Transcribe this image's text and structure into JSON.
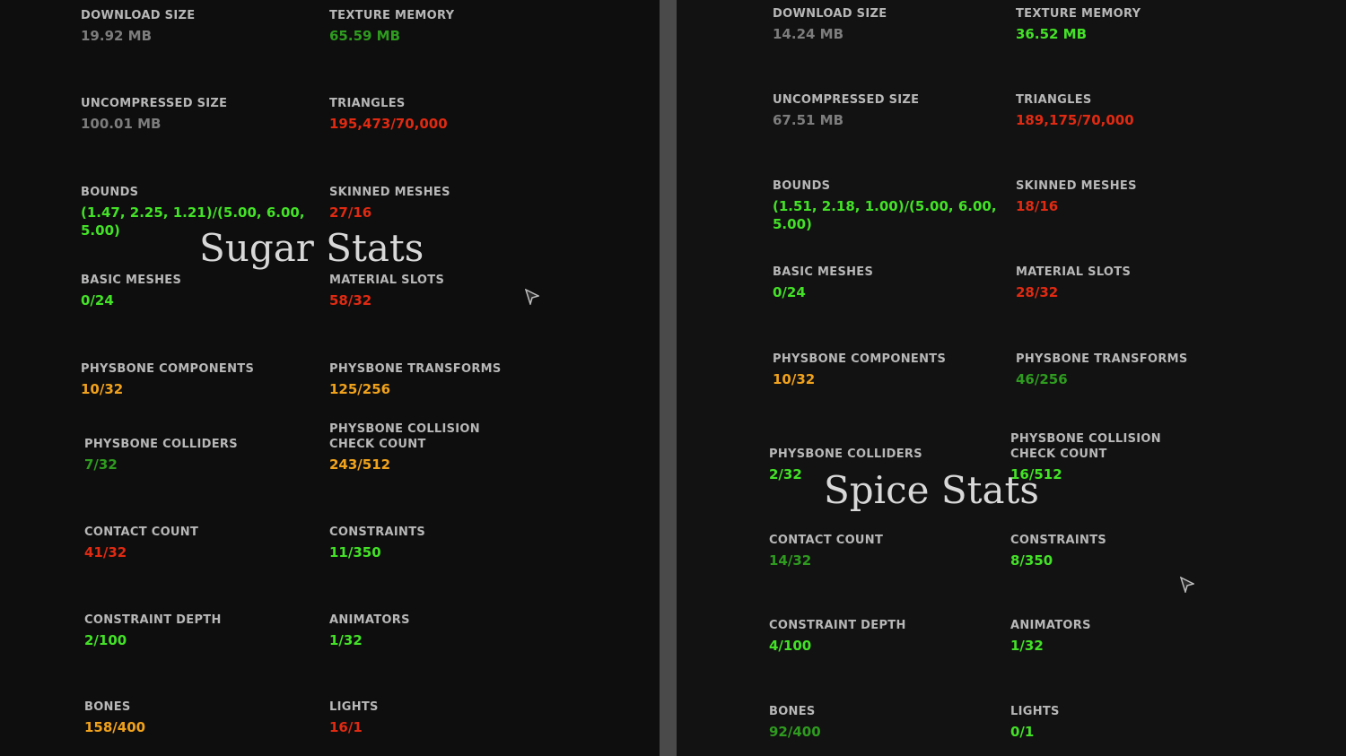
{
  "sugar": {
    "title": "Sugar Stats",
    "download_size": {
      "label": "DOWNLOAD SIZE",
      "value": "19.92 MB"
    },
    "texture_memory": {
      "label": "TEXTURE MEMORY",
      "value": "65.59 MB"
    },
    "uncompressed_size": {
      "label": "UNCOMPRESSED SIZE",
      "value": "100.01 MB"
    },
    "triangles": {
      "label": "TRIANGLES",
      "value": "195,473/70,000"
    },
    "bounds": {
      "label": "BOUNDS",
      "value": "(1.47, 2.25, 1.21)/(5.00, 6.00, 5.00)"
    },
    "skinned_meshes": {
      "label": "SKINNED MESHES",
      "value": "27/16"
    },
    "basic_meshes": {
      "label": "BASIC MESHES",
      "value": "0/24"
    },
    "material_slots": {
      "label": "MATERIAL SLOTS",
      "value": "58/32"
    },
    "physbone_components": {
      "label": "PHYSBONE COMPONENTS",
      "value": "10/32"
    },
    "physbone_transforms": {
      "label": "PHYSBONE TRANSFORMS",
      "value": "125/256"
    },
    "physbone_colliders": {
      "label": "PHYSBONE COLLIDERS",
      "value": "7/32"
    },
    "physbone_collision_check_count": {
      "label": "PHYSBONE COLLISION CHECK COUNT",
      "value": "243/512"
    },
    "contact_count": {
      "label": "CONTACT COUNT",
      "value": "41/32"
    },
    "constraints": {
      "label": "CONSTRAINTS",
      "value": "11/350"
    },
    "constraint_depth": {
      "label": "CONSTRAINT DEPTH",
      "value": "2/100"
    },
    "animators": {
      "label": "ANIMATORS",
      "value": "1/32"
    },
    "bones": {
      "label": "BONES",
      "value": "158/400"
    },
    "lights": {
      "label": "LIGHTS",
      "value": "16/1"
    }
  },
  "spice": {
    "title": "Spice Stats",
    "download_size": {
      "label": "DOWNLOAD SIZE",
      "value": "14.24 MB"
    },
    "texture_memory": {
      "label": "TEXTURE MEMORY",
      "value": "36.52 MB"
    },
    "uncompressed_size": {
      "label": "UNCOMPRESSED SIZE",
      "value": "67.51 MB"
    },
    "triangles": {
      "label": "TRIANGLES",
      "value": "189,175/70,000"
    },
    "bounds": {
      "label": "BOUNDS",
      "value": "(1.51, 2.18, 1.00)/(5.00, 6.00, 5.00)"
    },
    "skinned_meshes": {
      "label": "SKINNED MESHES",
      "value": "18/16"
    },
    "basic_meshes": {
      "label": "BASIC MESHES",
      "value": "0/24"
    },
    "material_slots": {
      "label": "MATERIAL SLOTS",
      "value": "28/32"
    },
    "physbone_components": {
      "label": "PHYSBONE COMPONENTS",
      "value": "10/32"
    },
    "physbone_transforms": {
      "label": "PHYSBONE TRANSFORMS",
      "value": "46/256"
    },
    "physbone_colliders": {
      "label": "PHYSBONE COLLIDERS",
      "value": "2/32"
    },
    "physbone_collision_check_count": {
      "label": "PHYSBONE COLLISION CHECK COUNT",
      "value": "16/512"
    },
    "contact_count": {
      "label": "CONTACT COUNT",
      "value": "14/32"
    },
    "constraints": {
      "label": "CONSTRAINTS",
      "value": "8/350"
    },
    "constraint_depth": {
      "label": "CONSTRAINT DEPTH",
      "value": "4/100"
    },
    "animators": {
      "label": "ANIMATORS",
      "value": "1/32"
    },
    "bones": {
      "label": "BONES",
      "value": "92/400"
    },
    "lights": {
      "label": "LIGHTS",
      "value": "0/1"
    }
  },
  "colors": {
    "label": "#b8b8b8",
    "neutral": "#7d7d7d",
    "good": "#24c11f",
    "excellent": "#43e227",
    "medium": "#2e9b1f",
    "poor": "#f0a21c",
    "very_poor": "#e02a12",
    "divider": "#4a4a4a"
  },
  "icons": [
    "cursor-arrow-icon"
  ]
}
